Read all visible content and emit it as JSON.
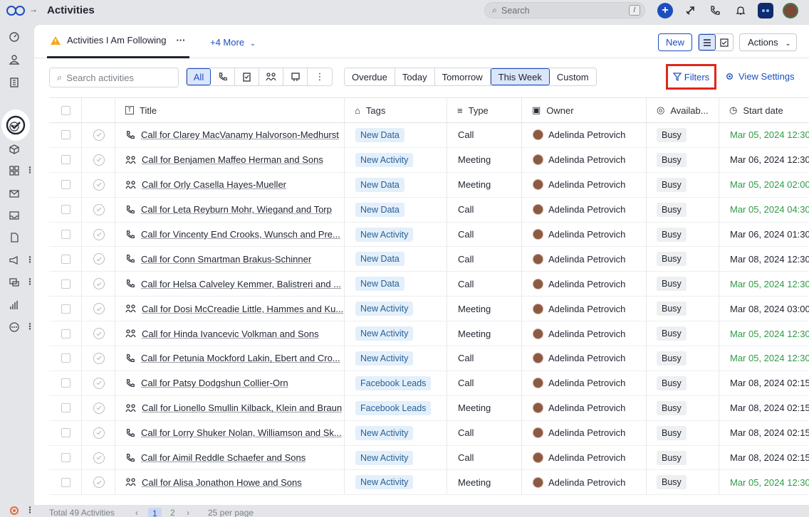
{
  "app": {
    "title": "Activities"
  },
  "top_search": {
    "placeholder": "Search",
    "shortcut": "/"
  },
  "tabs": {
    "active": "Activities I Am Following",
    "more": "+4 More"
  },
  "buttons": {
    "new": "New",
    "actions": "Actions"
  },
  "toolbar": {
    "search_placeholder": "Search activities",
    "type_filters": [
      "All",
      "call-icon",
      "task-icon",
      "meeting-icon",
      "note-icon",
      "more-icon"
    ],
    "type_active": "All",
    "date_filters": [
      "Overdue",
      "Today",
      "Tomorrow",
      "This Week",
      "Custom"
    ],
    "date_active": "This Week",
    "filters": "Filters",
    "view_settings": "View Settings"
  },
  "columns": [
    "Title",
    "Tags",
    "Type",
    "Owner",
    "Availab...",
    "Start date"
  ],
  "rows": [
    {
      "icon": "call-icon",
      "title": "Call for Clarey MacVanamy Halvorson-Medhurst",
      "tag": "New Data",
      "type": "Call",
      "owner": "Adelinda Petrovich",
      "avail": "Busy",
      "start": "Mar 05, 2024 12:30",
      "green": true
    },
    {
      "icon": "meeting-icon",
      "title": "Call for Benjamen Maffeo Herman and Sons",
      "tag": "New Activity",
      "type": "Meeting",
      "owner": "Adelinda Petrovich",
      "avail": "Busy",
      "start": "Mar 06, 2024 12:30",
      "green": false
    },
    {
      "icon": "meeting-icon",
      "title": "Call for Orly Casella Hayes-Mueller",
      "tag": "New Data",
      "type": "Meeting",
      "owner": "Adelinda Petrovich",
      "avail": "Busy",
      "start": "Mar 05, 2024 02:00",
      "green": true
    },
    {
      "icon": "call-icon",
      "title": "Call for Leta Reyburn Mohr, Wiegand and Torp",
      "tag": "New Data",
      "type": "Call",
      "owner": "Adelinda Petrovich",
      "avail": "Busy",
      "start": "Mar 05, 2024 04:30",
      "green": true
    },
    {
      "icon": "call-icon",
      "title": "Call for Vincenty End Crooks, Wunsch and Pre...",
      "tag": "New Activity",
      "type": "Call",
      "owner": "Adelinda Petrovich",
      "avail": "Busy",
      "start": "Mar 06, 2024 01:30",
      "green": false
    },
    {
      "icon": "call-icon",
      "title": "Call for Conn Smartman Brakus-Schinner",
      "tag": "New Data",
      "type": "Call",
      "owner": "Adelinda Petrovich",
      "avail": "Busy",
      "start": "Mar 08, 2024 12:30",
      "green": false
    },
    {
      "icon": "call-icon",
      "title": "Call for Helsa Calveley Kemmer, Balistreri and ...",
      "tag": "New Data",
      "type": "Call",
      "owner": "Adelinda Petrovich",
      "avail": "Busy",
      "start": "Mar 05, 2024 12:30",
      "green": true
    },
    {
      "icon": "meeting-icon",
      "title": "Call for Dosi McCreadie Little, Hammes and Ku...",
      "tag": "New Activity",
      "type": "Meeting",
      "owner": "Adelinda Petrovich",
      "avail": "Busy",
      "start": "Mar 08, 2024 03:00",
      "green": false
    },
    {
      "icon": "meeting-icon",
      "title": "Call for Hinda Ivancevic Volkman and Sons",
      "tag": "New Activity",
      "type": "Meeting",
      "owner": "Adelinda Petrovich",
      "avail": "Busy",
      "start": "Mar 05, 2024 12:30",
      "green": true
    },
    {
      "icon": "call-icon",
      "title": "Call for Petunia Mockford Lakin, Ebert and Cro...",
      "tag": "New Activity",
      "type": "Call",
      "owner": "Adelinda Petrovich",
      "avail": "Busy",
      "start": "Mar 05, 2024 12:30",
      "green": true
    },
    {
      "icon": "call-icon",
      "title": "Call for Patsy Dodgshun Collier-Orn",
      "tag": "Facebook Leads",
      "type": "Call",
      "owner": "Adelinda Petrovich",
      "avail": "Busy",
      "start": "Mar 08, 2024 02:15",
      "green": false
    },
    {
      "icon": "meeting-icon",
      "title": "Call for Lionello Smullin Kilback, Klein and Braun",
      "tag": "Facebook Leads",
      "type": "Meeting",
      "owner": "Adelinda Petrovich",
      "avail": "Busy",
      "start": "Mar 08, 2024 02:15",
      "green": false
    },
    {
      "icon": "call-icon",
      "title": "Call for Lorry Shuker Nolan, Williamson and Sk...",
      "tag": "New Activity",
      "type": "Call",
      "owner": "Adelinda Petrovich",
      "avail": "Busy",
      "start": "Mar 08, 2024 02:15",
      "green": false
    },
    {
      "icon": "call-icon",
      "title": "Call for Aimil Reddle Schaefer and Sons",
      "tag": "New Activity",
      "type": "Call",
      "owner": "Adelinda Petrovich",
      "avail": "Busy",
      "start": "Mar 08, 2024 02:15",
      "green": false
    },
    {
      "icon": "meeting-icon",
      "title": "Call for Alisa Jonathon Howe and Sons",
      "tag": "New Activity",
      "type": "Meeting",
      "owner": "Adelinda Petrovich",
      "avail": "Busy",
      "start": "Mar 05, 2024 12:30",
      "green": true
    }
  ],
  "footer": {
    "total": "Total 49 Activities",
    "pages": [
      "1",
      "2"
    ],
    "current_page": "1",
    "per_page": "25 per page"
  },
  "colors": {
    "accent": "#1c4ebf",
    "date_green": "#2f9a44",
    "highlight_red": "#e0261a"
  }
}
